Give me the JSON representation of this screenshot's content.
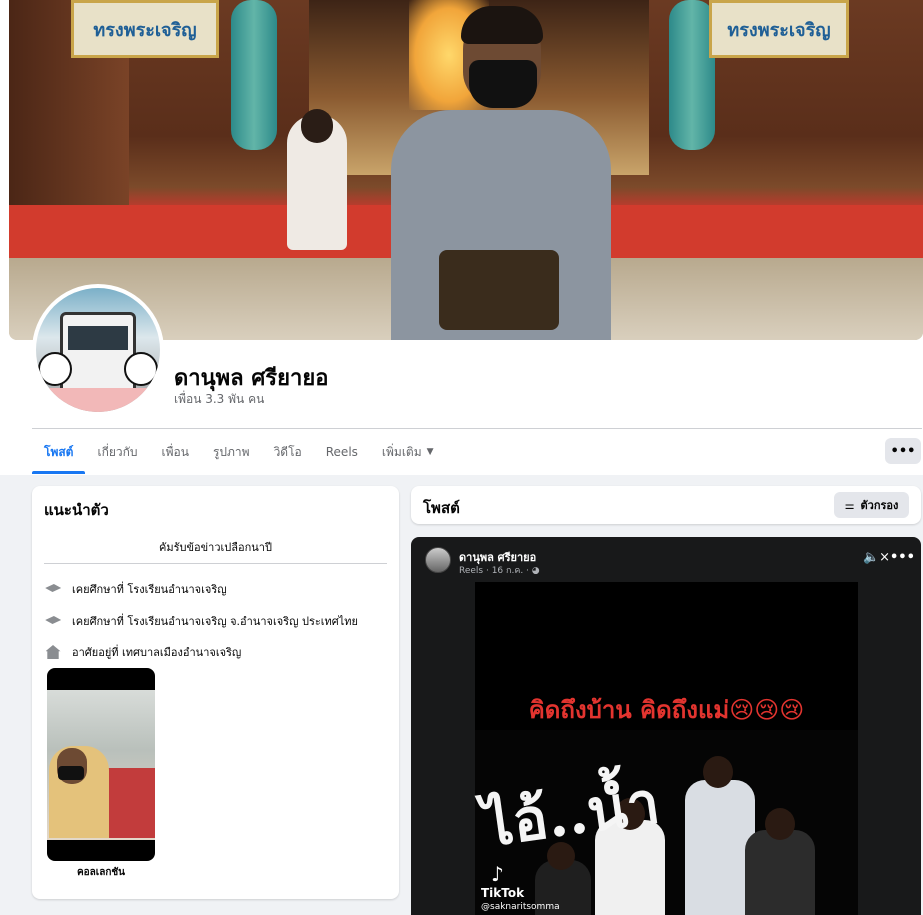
{
  "profile": {
    "name": "ดานุพล ศรียายอ",
    "friends": "เพื่อน 3.3 พัน คน"
  },
  "cover": {
    "banner_text": "ทรงพระเจริญ"
  },
  "tabs": [
    {
      "label": "โพสต์",
      "active": true
    },
    {
      "label": "เกี่ยวกับ",
      "active": false
    },
    {
      "label": "เพื่อน",
      "active": false
    },
    {
      "label": "รูปภาพ",
      "active": false
    },
    {
      "label": "วิดีโอ",
      "active": false
    },
    {
      "label": "Reels",
      "active": false
    },
    {
      "label": "เพิ่มเติม",
      "active": false
    }
  ],
  "more_button": "•••",
  "intro": {
    "title": "แนะนำตัว",
    "bio": "คัมรับข้อข่าวเปลือกนาปี",
    "items": [
      {
        "icon": "graduation-cap-icon",
        "text": "เคยศึกษาที่ โรงเรียนอำนาจเจริญ"
      },
      {
        "icon": "graduation-cap-icon",
        "text": "เคยศึกษาที่ โรงเรียนอำนาจเจริญ จ.อำนาจเจริญ ประเทศไทย"
      },
      {
        "icon": "home-icon",
        "text": "อาศัยอยู่ที่ เทศบาลเมืองอำนาจเจริญ"
      }
    ],
    "collection_label": "คอลเลกชัน"
  },
  "posts": {
    "title": "โพสต์",
    "filter_label": "ตัวกรอง"
  },
  "reel_post": {
    "author": "ดานุพล ศรียายอ",
    "meta": "Reels · 16 ก.ค. · ◕",
    "mute_icon": "🔈×",
    "more_icon": "•••",
    "caption": "คิดถึงบ้าน คิดถึงแม่😢😢😢",
    "overlay_text": "ไอ้..น้ำ",
    "tiktok_brand": "TikTok",
    "tiktok_handle": "@saknaritsomma"
  }
}
